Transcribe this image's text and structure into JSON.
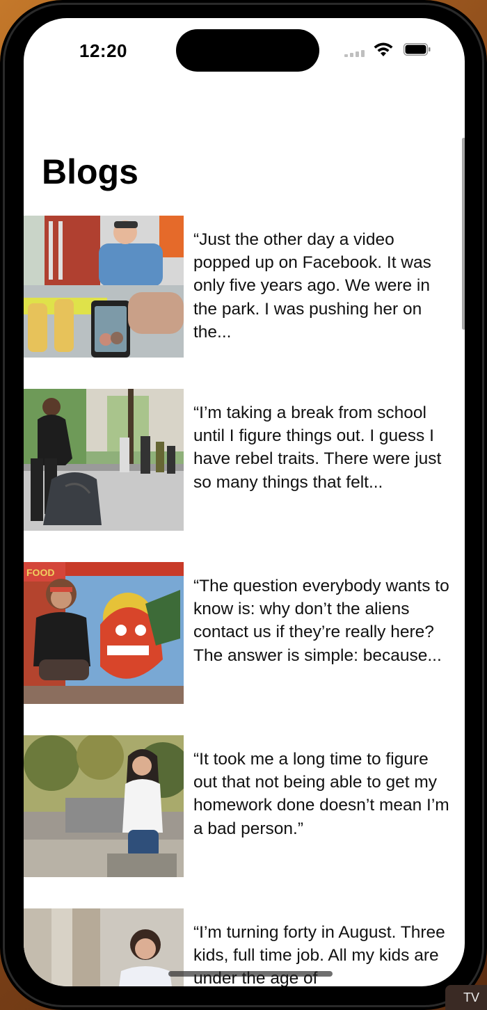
{
  "status_bar": {
    "time": "12:20"
  },
  "page": {
    "title": "Blogs"
  },
  "posts": [
    {
      "excerpt": "“Just the other day a video popped up on Facebook. It was only five years ago. We were in the park. I was pushing her on the..."
    },
    {
      "excerpt": "“I’m taking a break from school until I figure things out. I guess I have rebel traits. There were just so many things that felt..."
    },
    {
      "excerpt": "“The question everybody wants to know is: why don’t the aliens contact us if they’re really here? The answer is simple: because..."
    },
    {
      "excerpt": "“It took me a long time to figure out that not being able to get my homework done doesn’t mean I’m a bad person.”"
    },
    {
      "excerpt": "“I’m turning forty in August. Three kids, full time job. All my kids are under the age of"
    }
  ],
  "overlay": {
    "tag_label": "TV"
  }
}
